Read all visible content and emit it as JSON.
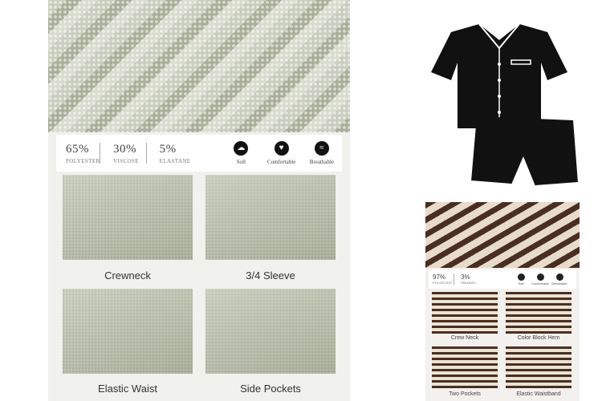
{
  "left_panel": {
    "composition": [
      {
        "percent": "65%",
        "material": "POLYESTER"
      },
      {
        "percent": "30%",
        "material": "VISCOSE"
      },
      {
        "percent": "5%",
        "material": "ELASTANE"
      }
    ],
    "features": [
      {
        "icon": "soft-icon",
        "label": "Soft"
      },
      {
        "icon": "comfortable-icon",
        "label": "Comfortable"
      },
      {
        "icon": "breathable-icon",
        "label": "Breathable"
      }
    ],
    "details": [
      {
        "caption": "Crewneck"
      },
      {
        "caption": "3/4 Sleeve"
      },
      {
        "caption": "Elastic Waist"
      },
      {
        "caption": "Side Pockets"
      }
    ],
    "colors": {
      "fabric": "#b8bca8",
      "background": "#f1f1ee"
    }
  },
  "product_top_right": {
    "colors": {
      "fabric": "#111111",
      "piping": "#ffffff"
    }
  },
  "right_panel": {
    "composition": [
      {
        "percent": "97%",
        "material": "POLYESTER"
      },
      {
        "percent": "3%",
        "material": "SPANDEX"
      }
    ],
    "features": [
      {
        "icon": "soft-icon",
        "label": "Soft"
      },
      {
        "icon": "comfortable-icon",
        "label": "Comfortable"
      },
      {
        "icon": "breathable-icon",
        "label": "Breathable"
      }
    ],
    "details": [
      {
        "caption": "Crew Neck"
      },
      {
        "caption": "Color Block Hem"
      },
      {
        "caption": "Two Pockets"
      },
      {
        "caption": "Elastic Waistband"
      }
    ],
    "colors": {
      "stripe_dark": "#4a2e22",
      "stripe_light": "#e7dcc9"
    }
  }
}
